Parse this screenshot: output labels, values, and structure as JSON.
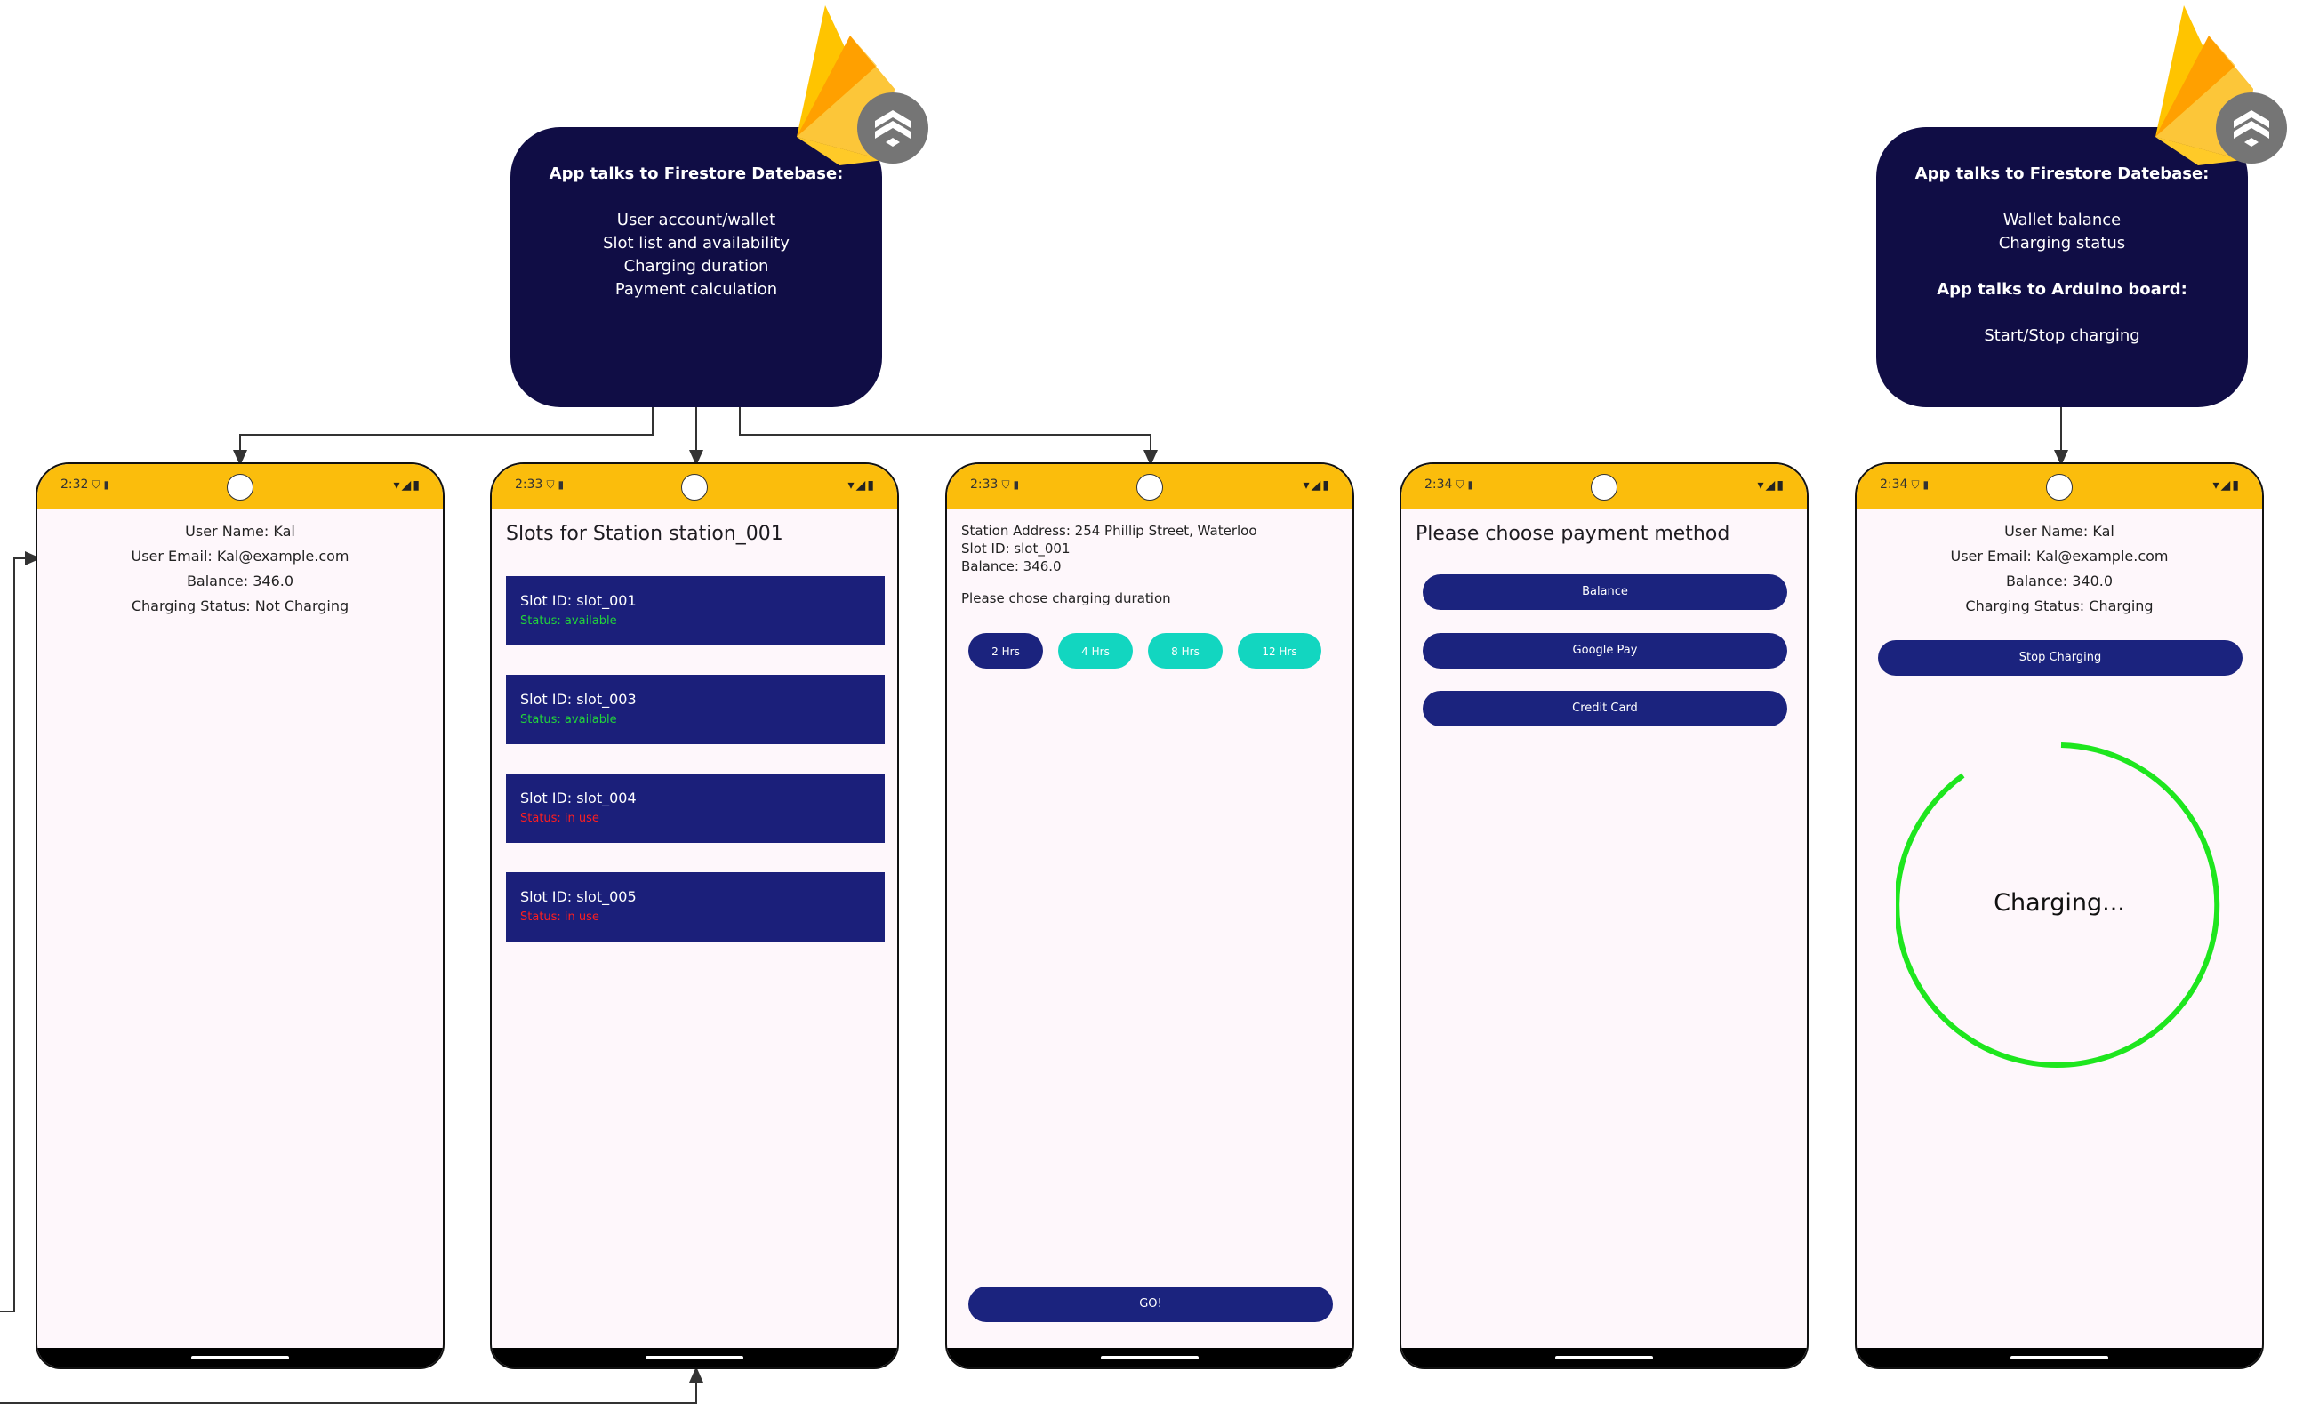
{
  "boxes": {
    "left": {
      "title": "App talks to Firestore Datebase:",
      "lines": [
        "User account/wallet",
        "Slot list and availability",
        "Charging duration",
        "Payment calculation"
      ]
    },
    "right": {
      "title1": "App talks to Firestore Datebase:",
      "lines1": [
        "Wallet balance",
        "Charging status"
      ],
      "title2": "App talks to Arduino board:",
      "lines2": [
        "Start/Stop charging"
      ]
    }
  },
  "screens": {
    "s1": {
      "time": "2:32",
      "user_name": "User Name: Kal",
      "user_email": "User Email: Kal@example.com",
      "balance": "Balance: 346.0",
      "charging_status": "Charging Status: Not Charging"
    },
    "s2": {
      "time": "2:33",
      "heading": "Slots for Station station_001",
      "slots": [
        {
          "id": "Slot ID: slot_001",
          "status": "Status: available"
        },
        {
          "id": "Slot ID: slot_003",
          "status": "Status: available"
        },
        {
          "id": "Slot ID: slot_004",
          "status": "Status: in use"
        },
        {
          "id": "Slot ID: slot_005",
          "status": "Status: in use"
        }
      ]
    },
    "s3": {
      "time": "2:33",
      "address": "Station Address: 254 Phillip Street, Waterloo",
      "slot_id": "Slot ID: slot_001",
      "balance": "Balance: 346.0",
      "prompt": "Please chose charging duration",
      "durations": [
        "2 Hrs",
        "4 Hrs",
        "8 Hrs",
        "12 Hrs"
      ],
      "go_label": "GO!"
    },
    "s4": {
      "time": "2:34",
      "heading": "Please choose payment method",
      "methods": [
        "Balance",
        "Google Pay",
        "Credit Card"
      ]
    },
    "s5": {
      "time": "2:34",
      "user_name": "User Name: Kal",
      "user_email": "User Email: Kal@example.com",
      "balance": "Balance: 340.0",
      "charging_status": "Charging Status: Charging",
      "stop_label": "Stop Charging",
      "charging_label": "Charging..."
    }
  },
  "colors": {
    "status_bar": "#fbbd0c",
    "info_box": "#100d45",
    "button_primary": "#1b237e",
    "button_teal": "#12d6c0",
    "slot_card": "#1b1f7a",
    "available": "#22d33a",
    "in_use": "#ff1f1f",
    "progress_ring": "#1ee61e"
  },
  "icons": [
    "firebase-logo-icon",
    "firestore-icon",
    "wifi-icon",
    "signal-icon",
    "battery-icon",
    "sim-card-icon",
    "shield-icon"
  ]
}
